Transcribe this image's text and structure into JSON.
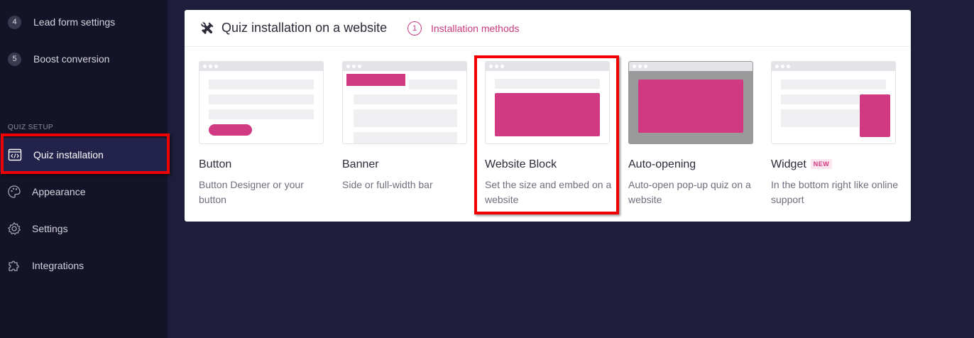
{
  "sidebar": {
    "steps": [
      {
        "number": "4",
        "label": "Lead form settings"
      },
      {
        "number": "5",
        "label": "Boost conversion"
      }
    ],
    "section_title": "QUIZ SETUP",
    "nav": [
      {
        "label": "Quiz installation",
        "icon": "code-window-icon",
        "active": true
      },
      {
        "label": "Appearance",
        "icon": "palette-icon"
      },
      {
        "label": "Settings",
        "icon": "gear-icon"
      },
      {
        "label": "Integrations",
        "icon": "puzzle-icon"
      }
    ]
  },
  "panel": {
    "title": "Quiz installation on a website",
    "title_icon": "tools-icon",
    "step_number": "1",
    "step_label": "Installation methods",
    "cards": [
      {
        "title": "Button",
        "description": "Button Designer or your button"
      },
      {
        "title": "Banner",
        "description": "Side or full-width bar"
      },
      {
        "title": "Website Block",
        "description": "Set the size and embed on a website",
        "highlighted": true
      },
      {
        "title": "Auto-opening",
        "description": "Auto-open pop-up quiz on a website"
      },
      {
        "title": "Widget",
        "badge": "NEW",
        "description": "In the bottom right like online support"
      }
    ]
  },
  "colors": {
    "background": "#1e1d3b",
    "sidebar": "#141327",
    "accent": "#d13a82",
    "highlight": "#f00000"
  }
}
